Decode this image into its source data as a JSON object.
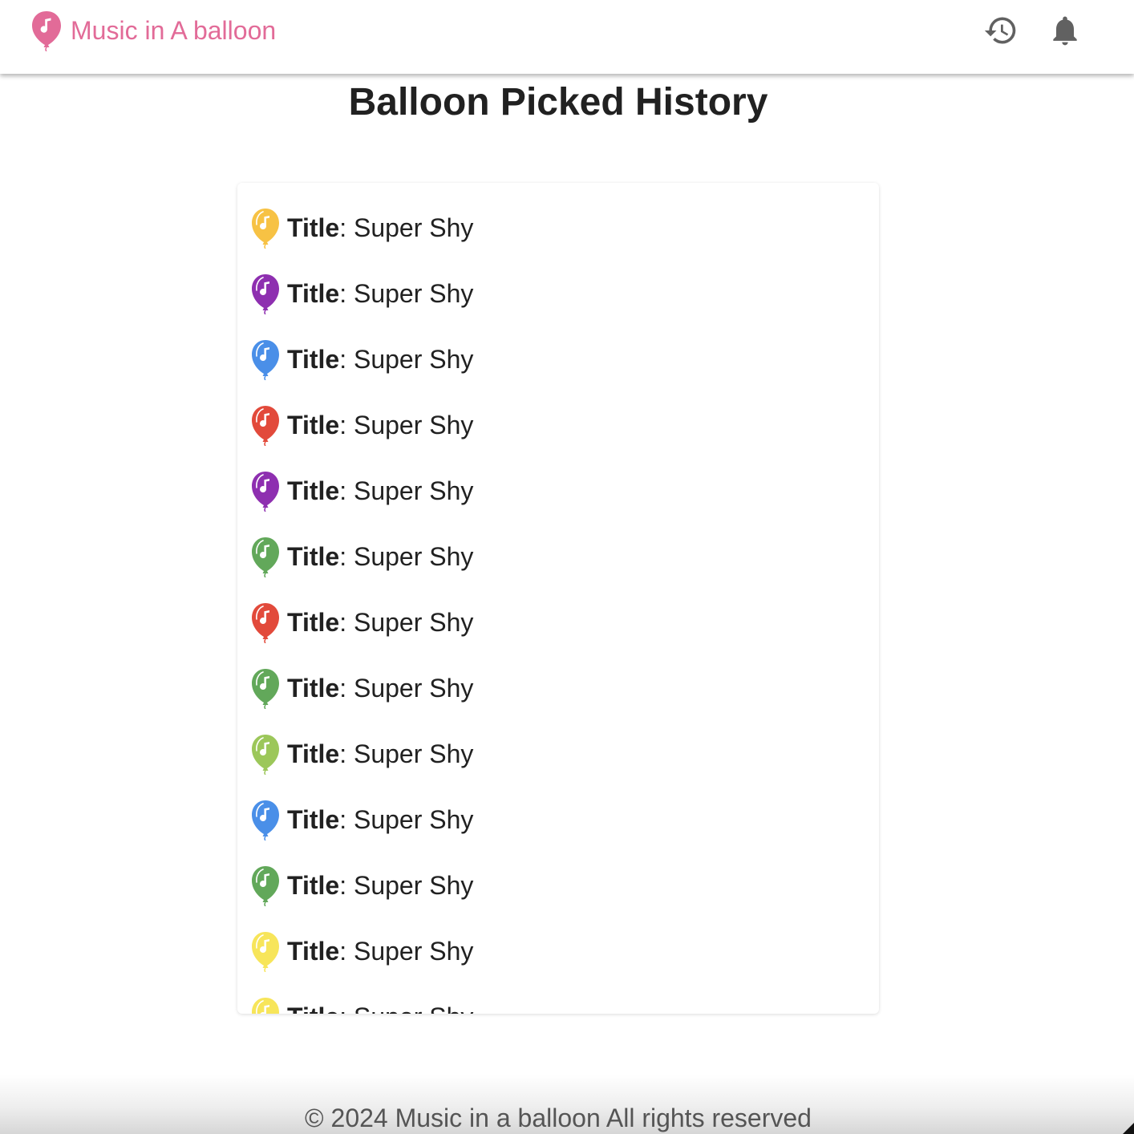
{
  "header": {
    "brand_name": "Music in A balloon",
    "brand_color": "#e26b98",
    "brand_icon": "balloon-music-icon",
    "actions": [
      {
        "name": "history-button",
        "icon": "history-icon"
      },
      {
        "name": "notifications-button",
        "icon": "bell-icon"
      }
    ]
  },
  "page": {
    "title": "Balloon Picked History"
  },
  "history": {
    "items": [
      {
        "label": "Title",
        "separator": ":",
        "value": "Super Shy",
        "balloon_color": "#f7c244"
      },
      {
        "label": "Title",
        "separator": ":",
        "value": "Super Shy",
        "balloon_color": "#8e2fb0"
      },
      {
        "label": "Title",
        "separator": ":",
        "value": "Super Shy",
        "balloon_color": "#4a8fe8"
      },
      {
        "label": "Title",
        "separator": ":",
        "value": "Super Shy",
        "balloon_color": "#e24a3b"
      },
      {
        "label": "Title",
        "separator": ":",
        "value": "Super Shy",
        "balloon_color": "#8e2fb0"
      },
      {
        "label": "Title",
        "separator": ":",
        "value": "Super Shy",
        "balloon_color": "#62a85a"
      },
      {
        "label": "Title",
        "separator": ":",
        "value": "Super Shy",
        "balloon_color": "#e24a3b"
      },
      {
        "label": "Title",
        "separator": ":",
        "value": "Super Shy",
        "balloon_color": "#62a85a"
      },
      {
        "label": "Title",
        "separator": ":",
        "value": "Super Shy",
        "balloon_color": "#9cc75a"
      },
      {
        "label": "Title",
        "separator": ":",
        "value": "Super Shy",
        "balloon_color": "#4a8fe8"
      },
      {
        "label": "Title",
        "separator": ":",
        "value": "Super Shy",
        "balloon_color": "#62a85a"
      },
      {
        "label": "Title",
        "separator": ":",
        "value": "Super Shy",
        "balloon_color": "#f7e55a"
      },
      {
        "label": "Title",
        "separator": ":",
        "value": "Super Shy",
        "balloon_color": "#f7e55a"
      }
    ]
  },
  "footer": {
    "text": "© 2024 Music in a balloon All rights reserved"
  }
}
